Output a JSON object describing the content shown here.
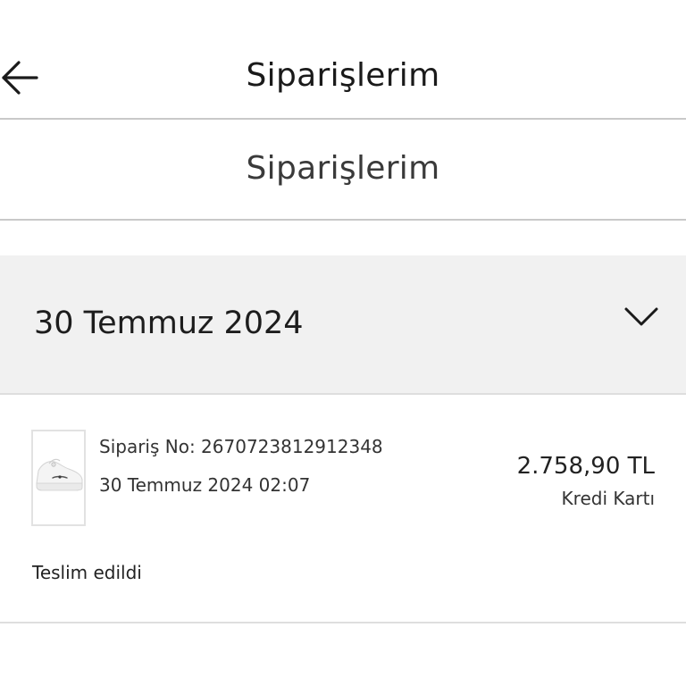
{
  "header": {
    "title": "Siparişlerim",
    "back_icon": "arrow-left-icon"
  },
  "section": {
    "title": "Siparişlerim"
  },
  "order_groups": [
    {
      "date": "30 Temmuz 2024",
      "expanded": true,
      "toggle_icon": "chevron-down-icon",
      "orders": [
        {
          "order_no_text": "Sipariş No: 2670723812912348",
          "datetime": "30 Temmuz 2024 02:07",
          "price": "2.758,90 TL",
          "payment": "Kredi Kartı",
          "status": "Teslim edildi",
          "thumbnail": "white-sneaker-thumbnail"
        }
      ]
    }
  ],
  "colors": {
    "divider": "#c9c9c9",
    "group_bg": "#f1f1f1",
    "text": "#222222"
  }
}
